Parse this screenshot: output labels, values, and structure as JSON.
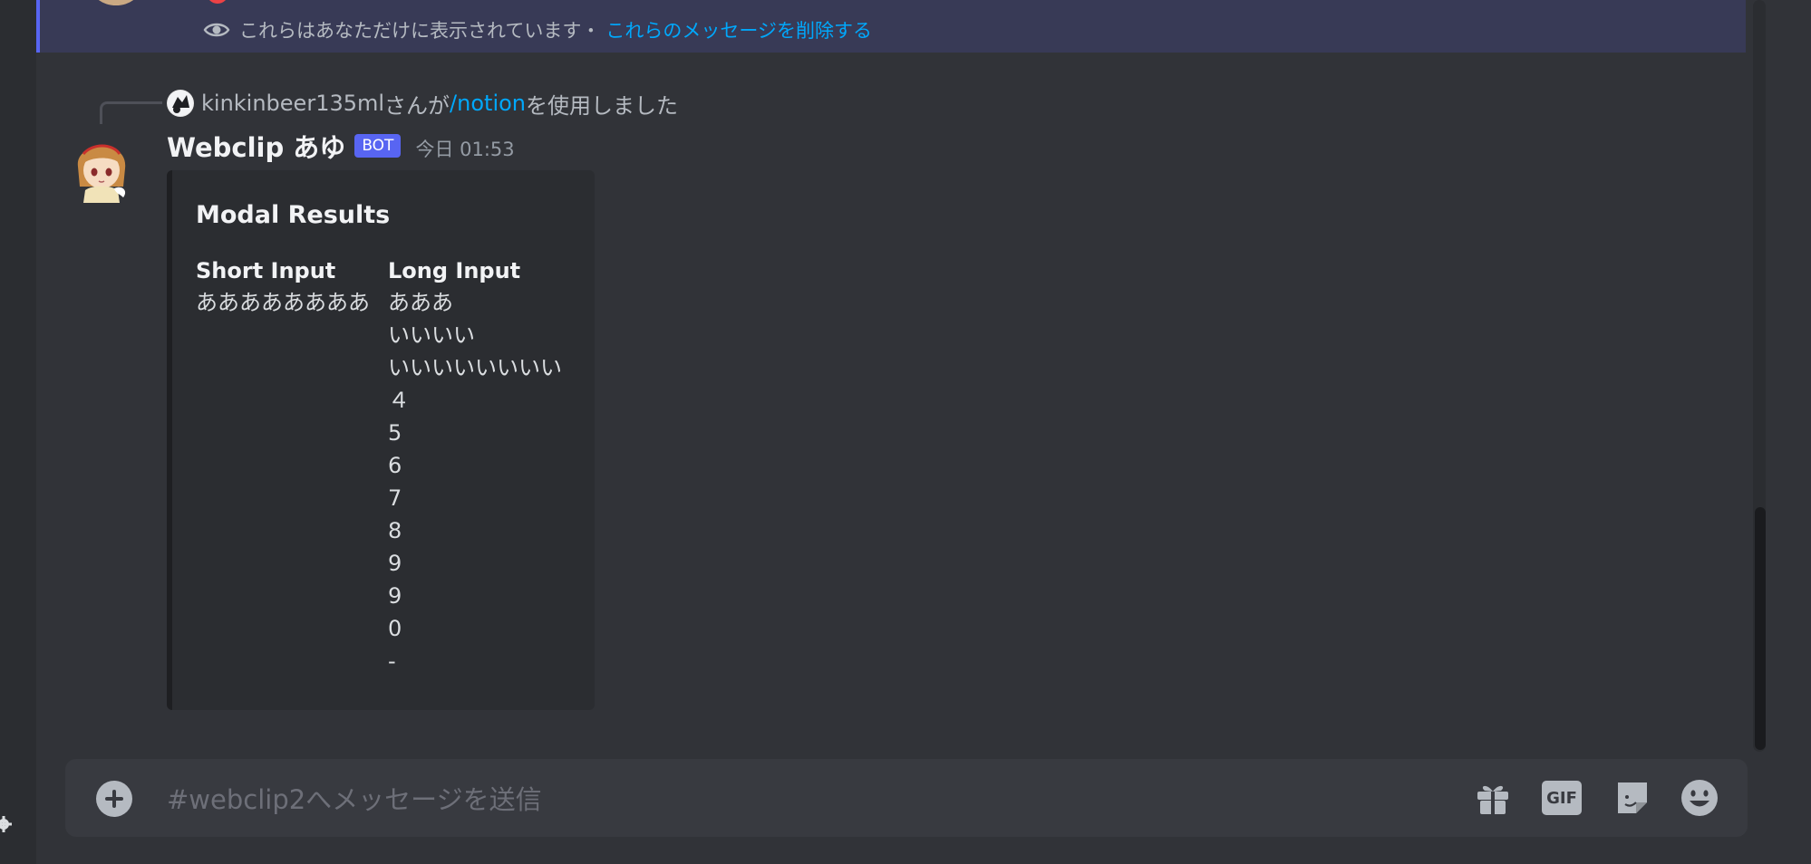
{
  "ephemeral": {
    "notice": "これらはあなただけに表示されています・",
    "dismiss_link": "これらのメッセージを削除する"
  },
  "reply": {
    "user": "kinkinbeer135ml",
    "connector": "さんが",
    "command": "/notion",
    "suffix": "を使用しました"
  },
  "message": {
    "username": "Webclip あゆ",
    "bot_tag": "BOT",
    "timestamp": "今日 01:53",
    "embed": {
      "title": "Modal Results",
      "fields": [
        {
          "name": "Short Input",
          "value": "ああああああああ"
        },
        {
          "name": "Long Input",
          "value": "あああ\nいいいい\nいいいいいいいい\n４\n5\n6\n7\n8\n9\n9\n0\n-"
        }
      ]
    }
  },
  "composer": {
    "placeholder": "#webclip2へメッセージを送信",
    "gif_label": "GIF"
  },
  "colors": {
    "accent": "#5865f2",
    "link": "#00a8fc",
    "background": "#313338"
  },
  "icons": [
    "eye-icon",
    "plus-circle-icon",
    "gift-icon",
    "gif-icon",
    "sticker-icon",
    "emoji-icon",
    "gear-icon"
  ]
}
